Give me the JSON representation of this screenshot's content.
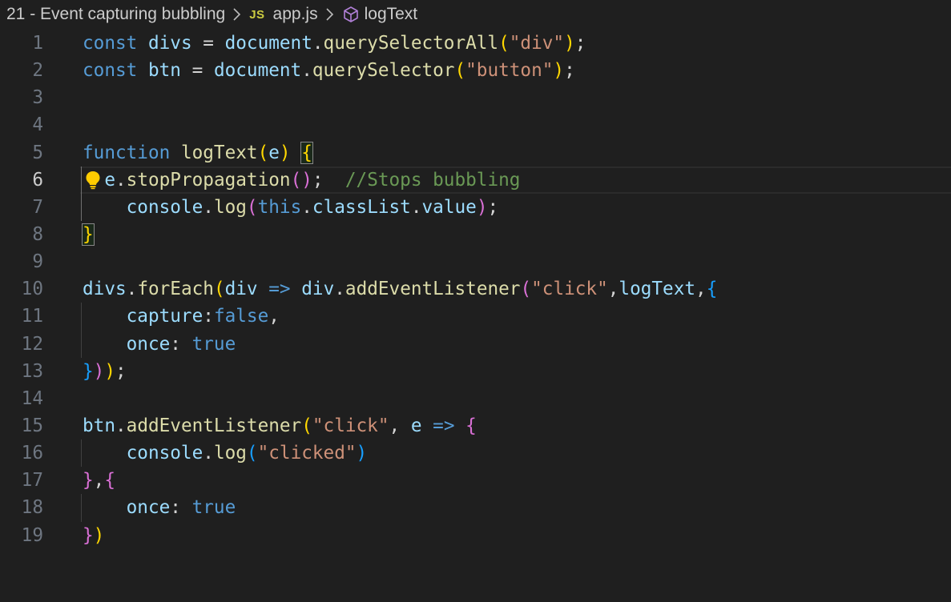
{
  "breadcrumb": {
    "folder": "21 - Event capturing bubbling",
    "file_badge": "JS",
    "file": "app.js",
    "symbol": "logText"
  },
  "editor": {
    "current_line": 6,
    "icons": [
      "chevron-right-icon",
      "javascript-file-icon",
      "method-symbol-icon",
      "lightbulb-icon"
    ],
    "colors": {
      "background": "#1f1f1f",
      "keyword": "#569cd6",
      "variable": "#9cdcfe",
      "function": "#dcdcaa",
      "string": "#ce9178",
      "comment": "#6a9955",
      "bracket_level1": "#ffd700",
      "bracket_level2": "#da70d6",
      "bracket_level3": "#179fff",
      "lightbulb": "#ffcc00"
    },
    "lines": [
      {
        "n": "1",
        "tokens": [
          [
            "kw",
            "const "
          ],
          [
            "var",
            "divs "
          ],
          [
            "op",
            "= "
          ],
          [
            "var",
            "document"
          ],
          [
            "pl",
            "."
          ],
          [
            "fn",
            "querySelectorAll"
          ],
          [
            "b1",
            "("
          ],
          [
            "str",
            "\"div\""
          ],
          [
            "b1",
            ")"
          ],
          [
            "pl",
            ";"
          ]
        ]
      },
      {
        "n": "2",
        "tokens": [
          [
            "kw",
            "const "
          ],
          [
            "var",
            "btn "
          ],
          [
            "op",
            "= "
          ],
          [
            "var",
            "document"
          ],
          [
            "pl",
            "."
          ],
          [
            "fn",
            "querySelector"
          ],
          [
            "b1",
            "("
          ],
          [
            "str",
            "\"button\""
          ],
          [
            "b1",
            ")"
          ],
          [
            "pl",
            ";"
          ]
        ]
      },
      {
        "n": "3",
        "tokens": []
      },
      {
        "n": "4",
        "tokens": []
      },
      {
        "n": "5",
        "tokens": [
          [
            "kw",
            "function "
          ],
          [
            "fn",
            "logText"
          ],
          [
            "b1",
            "("
          ],
          [
            "var",
            "e"
          ],
          [
            "b1",
            ")"
          ],
          [
            "pl",
            " "
          ],
          [
            "b1",
            "{"
          ]
        ]
      },
      {
        "n": "6",
        "tokens": [
          [
            "pl",
            "  "
          ],
          [
            "var",
            "e"
          ],
          [
            "pl",
            "."
          ],
          [
            "fn",
            "stopPropagation"
          ],
          [
            "b2",
            "()"
          ],
          [
            "pl",
            ";  "
          ],
          [
            "cm",
            "//Stops bubbling"
          ]
        ]
      },
      {
        "n": "7",
        "tokens": [
          [
            "pl",
            "    "
          ],
          [
            "var",
            "console"
          ],
          [
            "pl",
            "."
          ],
          [
            "fn",
            "log"
          ],
          [
            "b2",
            "("
          ],
          [
            "kw",
            "this"
          ],
          [
            "pl",
            "."
          ],
          [
            "var",
            "classList"
          ],
          [
            "pl",
            "."
          ],
          [
            "var",
            "value"
          ],
          [
            "b2",
            ")"
          ],
          [
            "pl",
            ";"
          ]
        ]
      },
      {
        "n": "8",
        "tokens": [
          [
            "b1",
            "}"
          ]
        ]
      },
      {
        "n": "9",
        "tokens": []
      },
      {
        "n": "10",
        "tokens": [
          [
            "var",
            "divs"
          ],
          [
            "pl",
            "."
          ],
          [
            "fn",
            "forEach"
          ],
          [
            "b1",
            "("
          ],
          [
            "var",
            "div "
          ],
          [
            "kw",
            "=>"
          ],
          [
            "pl",
            " "
          ],
          [
            "var",
            "div"
          ],
          [
            "pl",
            "."
          ],
          [
            "fn",
            "addEventListener"
          ],
          [
            "b2",
            "("
          ],
          [
            "str",
            "\"click\""
          ],
          [
            "pl",
            ","
          ],
          [
            "var",
            "logText"
          ],
          [
            "pl",
            ","
          ],
          [
            "b3",
            "{"
          ]
        ]
      },
      {
        "n": "11",
        "tokens": [
          [
            "pl",
            "    "
          ],
          [
            "var",
            "capture"
          ],
          [
            "pl",
            ":"
          ],
          [
            "kw",
            "false"
          ],
          [
            "pl",
            ","
          ]
        ]
      },
      {
        "n": "12",
        "tokens": [
          [
            "pl",
            "    "
          ],
          [
            "var",
            "once"
          ],
          [
            "pl",
            ": "
          ],
          [
            "kw",
            "true"
          ]
        ]
      },
      {
        "n": "13",
        "tokens": [
          [
            "b3",
            "}"
          ],
          [
            "b2",
            ")"
          ],
          [
            "b1",
            ")"
          ],
          [
            "pl",
            ";"
          ]
        ]
      },
      {
        "n": "14",
        "tokens": []
      },
      {
        "n": "15",
        "tokens": [
          [
            "var",
            "btn"
          ],
          [
            "pl",
            "."
          ],
          [
            "fn",
            "addEventListener"
          ],
          [
            "b1",
            "("
          ],
          [
            "str",
            "\"click\""
          ],
          [
            "pl",
            ", "
          ],
          [
            "var",
            "e "
          ],
          [
            "kw",
            "=>"
          ],
          [
            "pl",
            " "
          ],
          [
            "b2",
            "{"
          ]
        ]
      },
      {
        "n": "16",
        "tokens": [
          [
            "pl",
            "    "
          ],
          [
            "var",
            "console"
          ],
          [
            "pl",
            "."
          ],
          [
            "fn",
            "log"
          ],
          [
            "b3",
            "("
          ],
          [
            "str",
            "\"clicked\""
          ],
          [
            "b3",
            ")"
          ]
        ]
      },
      {
        "n": "17",
        "tokens": [
          [
            "b2",
            "}"
          ],
          [
            "pl",
            ","
          ],
          [
            "b2",
            "{"
          ]
        ]
      },
      {
        "n": "18",
        "tokens": [
          [
            "pl",
            "    "
          ],
          [
            "var",
            "once"
          ],
          [
            "pl",
            ": "
          ],
          [
            "kw",
            "true"
          ]
        ]
      },
      {
        "n": "19",
        "tokens": [
          [
            "b2",
            "}"
          ],
          [
            "b1",
            ")"
          ]
        ]
      }
    ]
  }
}
